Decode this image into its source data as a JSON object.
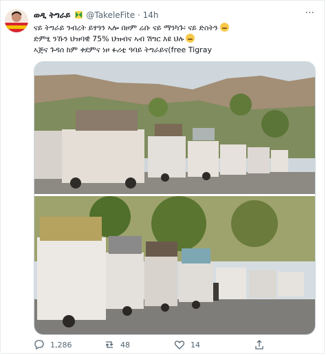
{
  "tweet": {
    "author_name": "ወዲ ትግራይ",
    "handle": "@TakeleFite",
    "separator": "·",
    "time": "14h",
    "lines": [
      "ናይ ትግራይ ንብረት ይፃዓን ኣሎ በዞም ሬቡ ናይ ማንካጉ፡ ናይ ድስትን",
      "ድምፂ ንኹን ህዝባዊ 75% ህዝብና ኣብ ሽግር እዩ ህሉ",
      "ኣጅና ጉዳሰ ከም ቀደምና ነዞ ፉሪቲ ዓባይ ትግራይና(free Tigray"
    ]
  },
  "actions": {
    "replies": "1,286",
    "retweets": "48",
    "likes": "14",
    "share": ""
  },
  "colors": {
    "text": "#0f1419",
    "secondary": "#536471",
    "border": "#cfd9de"
  },
  "icons": {
    "badge": "green-yellow-badge-icon",
    "emoji": "worried-face-icon",
    "reply": "reply-icon",
    "retweet": "retweet-icon",
    "like": "heart-icon",
    "share": "share-icon"
  }
}
